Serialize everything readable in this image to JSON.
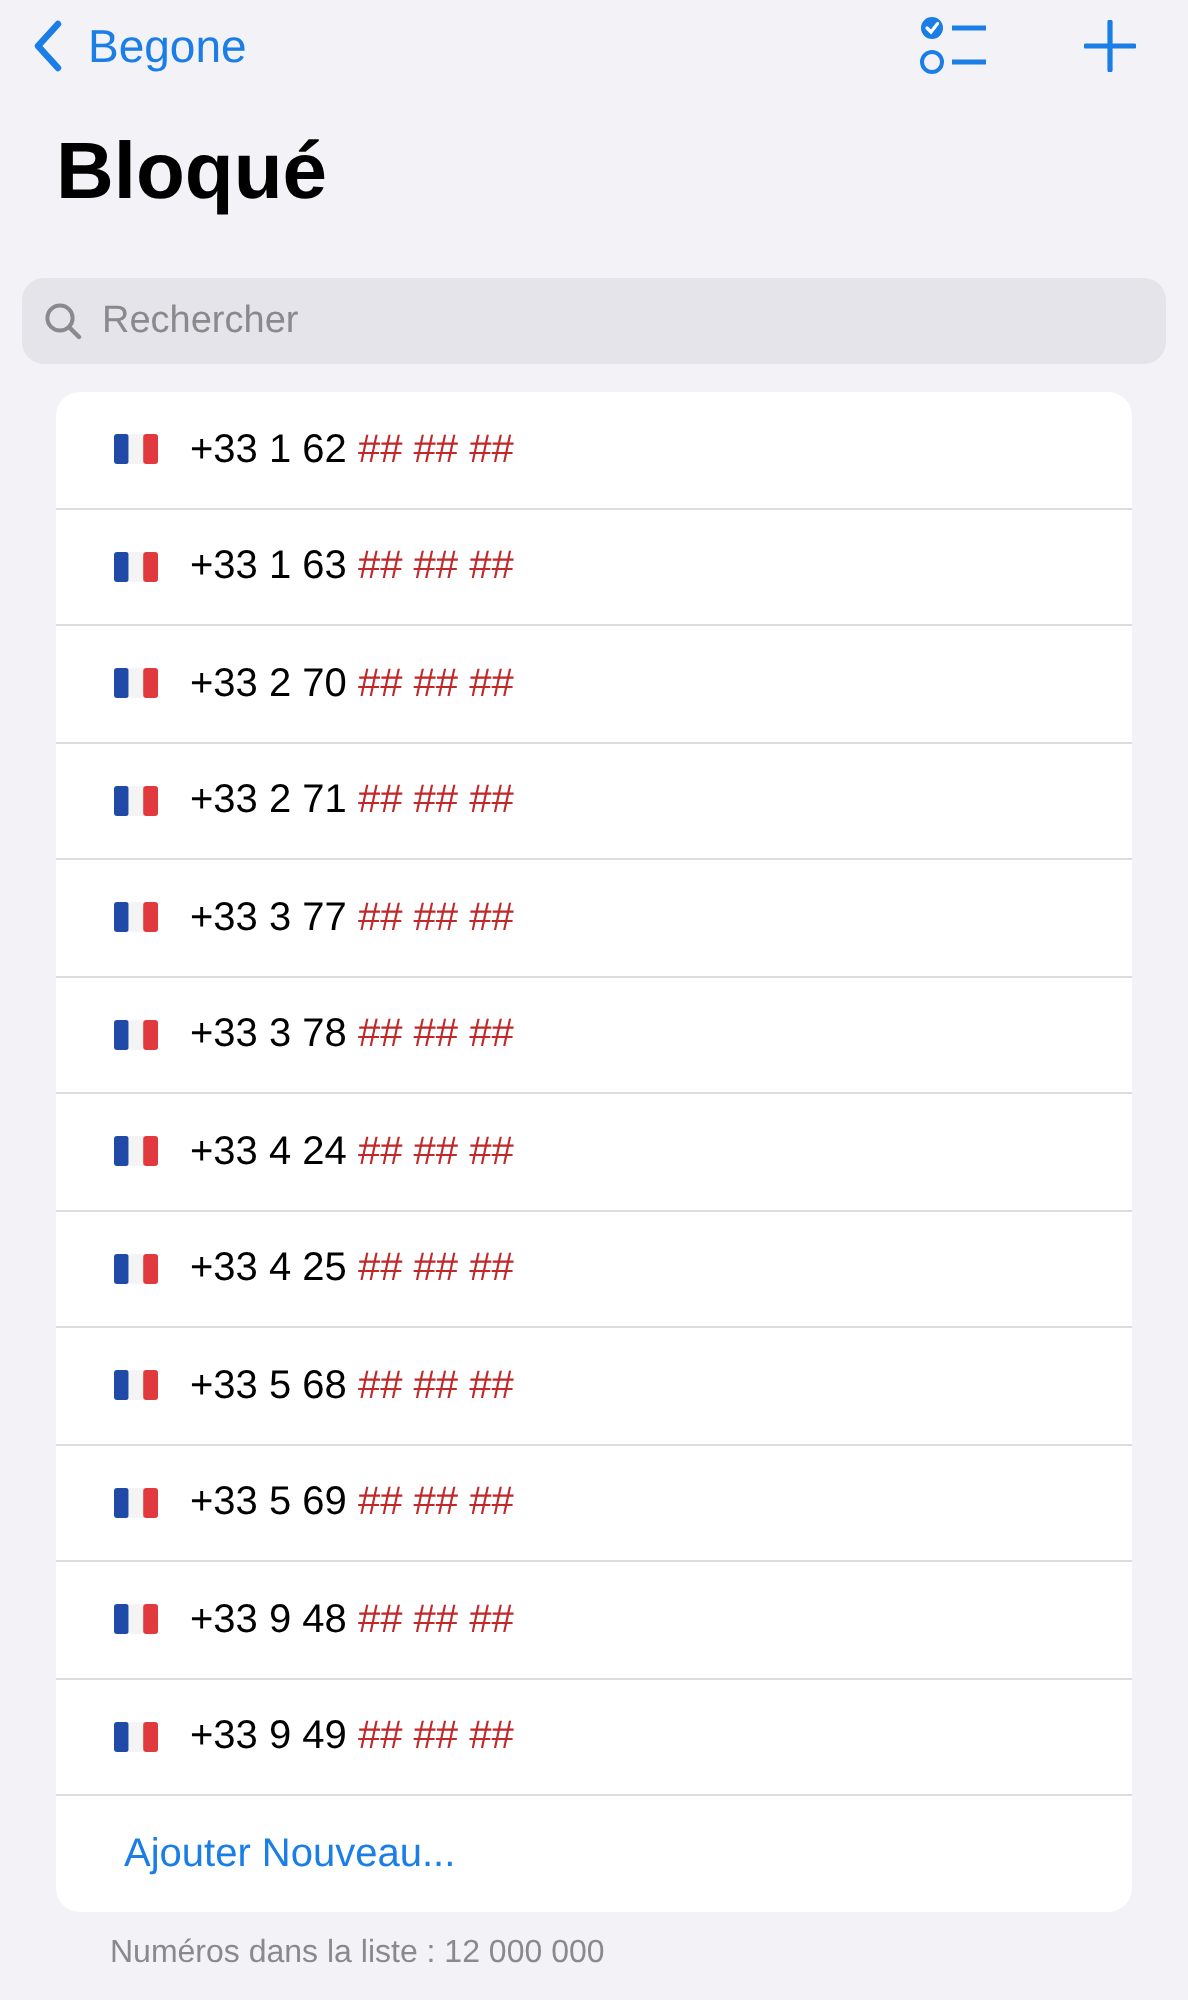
{
  "nav": {
    "back_label": "Begone"
  },
  "title": "Bloqué",
  "search": {
    "placeholder": "Rechercher"
  },
  "numbers": [
    {
      "prefix": "+33 1 62",
      "mask": "## ## ##"
    },
    {
      "prefix": "+33 1 63",
      "mask": "## ## ##"
    },
    {
      "prefix": "+33 2 70",
      "mask": "## ## ##"
    },
    {
      "prefix": "+33 2 71",
      "mask": "## ## ##"
    },
    {
      "prefix": "+33 3 77",
      "mask": "## ## ##"
    },
    {
      "prefix": "+33 3 78",
      "mask": "## ## ##"
    },
    {
      "prefix": "+33 4 24",
      "mask": "## ## ##"
    },
    {
      "prefix": "+33 4 25",
      "mask": "## ## ##"
    },
    {
      "prefix": "+33 5 68",
      "mask": "## ## ##"
    },
    {
      "prefix": "+33 5 69",
      "mask": "## ## ##"
    },
    {
      "prefix": "+33 9 48",
      "mask": "## ## ##"
    },
    {
      "prefix": "+33 9 49",
      "mask": "## ## ##"
    }
  ],
  "add_label": "Ajouter Nouveau...",
  "footer": "Numéros dans la liste : 12 000 000"
}
